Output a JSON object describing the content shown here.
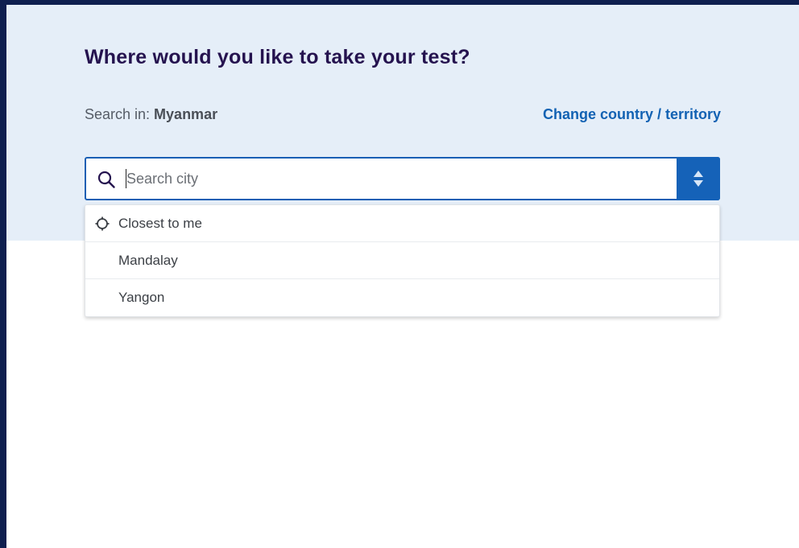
{
  "header": {
    "title": "Where would you like to take your test?"
  },
  "location": {
    "prefix": "Search in: ",
    "country": "Myanmar",
    "change_link": "Change country / territory"
  },
  "search": {
    "placeholder": "Search city",
    "value": ""
  },
  "options": [
    {
      "label": "Closest to me",
      "icon": "crosshair-icon"
    },
    {
      "label": "Mandalay"
    },
    {
      "label": "Yangon"
    }
  ],
  "colors": {
    "frame_border": "#0e1f4f",
    "panel_background": "#e5eef8",
    "title_color": "#25134f",
    "link_color": "#1262b3",
    "accent": "#1562b8"
  }
}
